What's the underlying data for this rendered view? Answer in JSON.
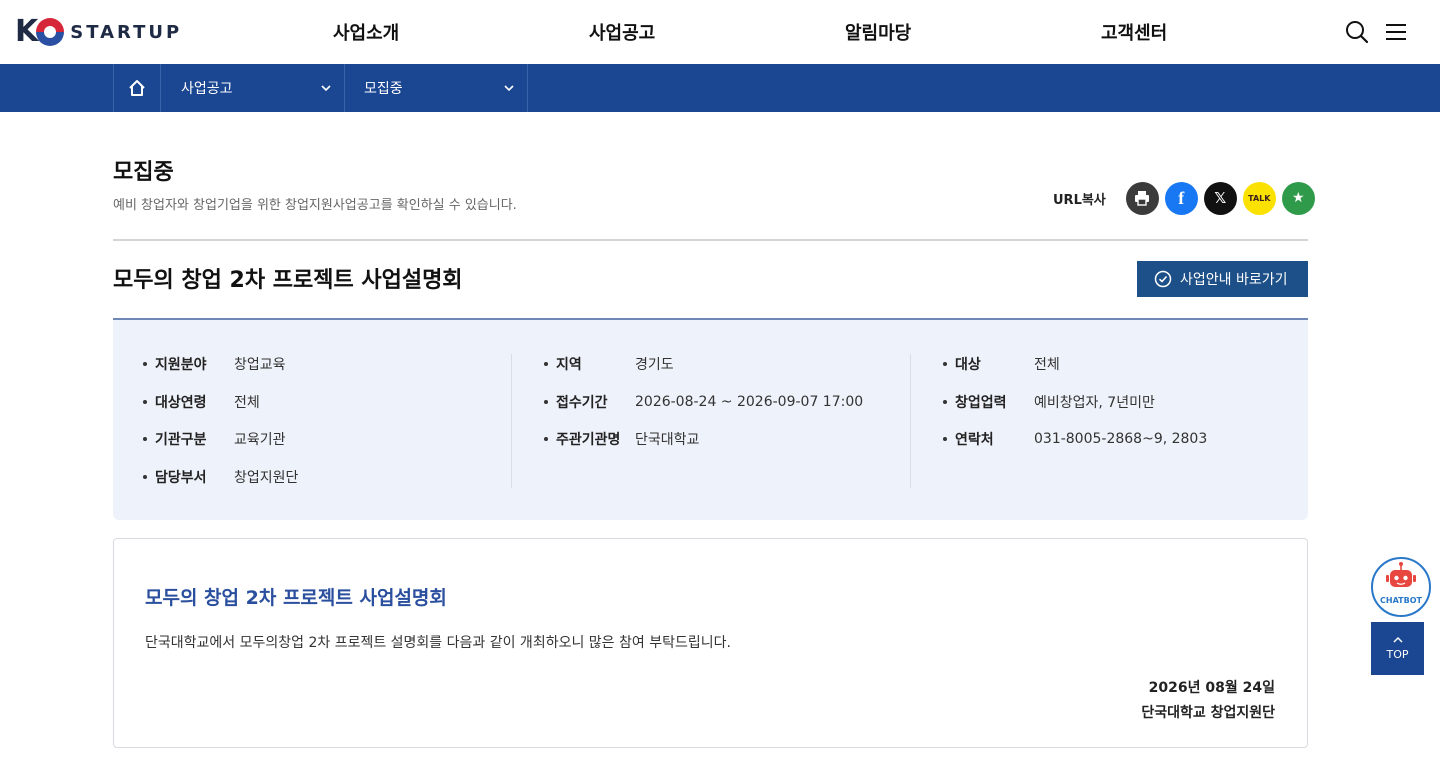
{
  "header": {
    "logo_text": "STARTUP",
    "nav": [
      "사업소개",
      "사업공고",
      "알림마당",
      "고객센터"
    ],
    "icons": [
      "search-icon",
      "menu-icon"
    ]
  },
  "breadcrumb": {
    "home_icon": "home-icon",
    "level1": "사업공고",
    "level2": "모집중"
  },
  "page": {
    "title": "모집중",
    "description": "예비 창업자와 창업기업을 위한 창업지원사업공고를 확인하실 수 있습니다."
  },
  "share": {
    "label": "URL복사",
    "buttons": [
      "print-icon",
      "facebook-icon",
      "x-icon",
      "kakaotalk-icon",
      "favorite-icon"
    ],
    "talk_text": "TALK"
  },
  "announcement": {
    "title": "모두의 창업 2차 프로젝트 사업설명회",
    "go_button": "사업안내 바로가기"
  },
  "info": {
    "col1": [
      {
        "label": "지원분야",
        "value": "창업교육"
      },
      {
        "label": "대상연령",
        "value": "전체"
      },
      {
        "label": "기관구분",
        "value": "교육기관"
      },
      {
        "label": "담당부서",
        "value": "창업지원단"
      }
    ],
    "col2": [
      {
        "label": "지역",
        "value": "경기도"
      },
      {
        "label": "접수기간",
        "value": "2026-08-24 ~ 2026-09-07 17:00"
      },
      {
        "label": "주관기관명",
        "value": "단국대학교"
      }
    ],
    "col3": [
      {
        "label": "대상",
        "value": "전체"
      },
      {
        "label": "창업업력",
        "value": "예비창업자, 7년미만"
      },
      {
        "label": "연락처",
        "value": "031-8005-2868~9, 2803"
      }
    ]
  },
  "content": {
    "title": "모두의 창업 2차 프로젝트 사업설명회",
    "body": "단국대학교에서 모두의창업 2차 프로젝트 설명회를 다음과 같이 개최하오니 많은 참여 부탁드립니다.",
    "date": "2026년 08월 24일",
    "org": "단국대학교 창업지원단"
  },
  "floating": {
    "chatbot_label": "CHATBOT",
    "top_label": "TOP"
  }
}
